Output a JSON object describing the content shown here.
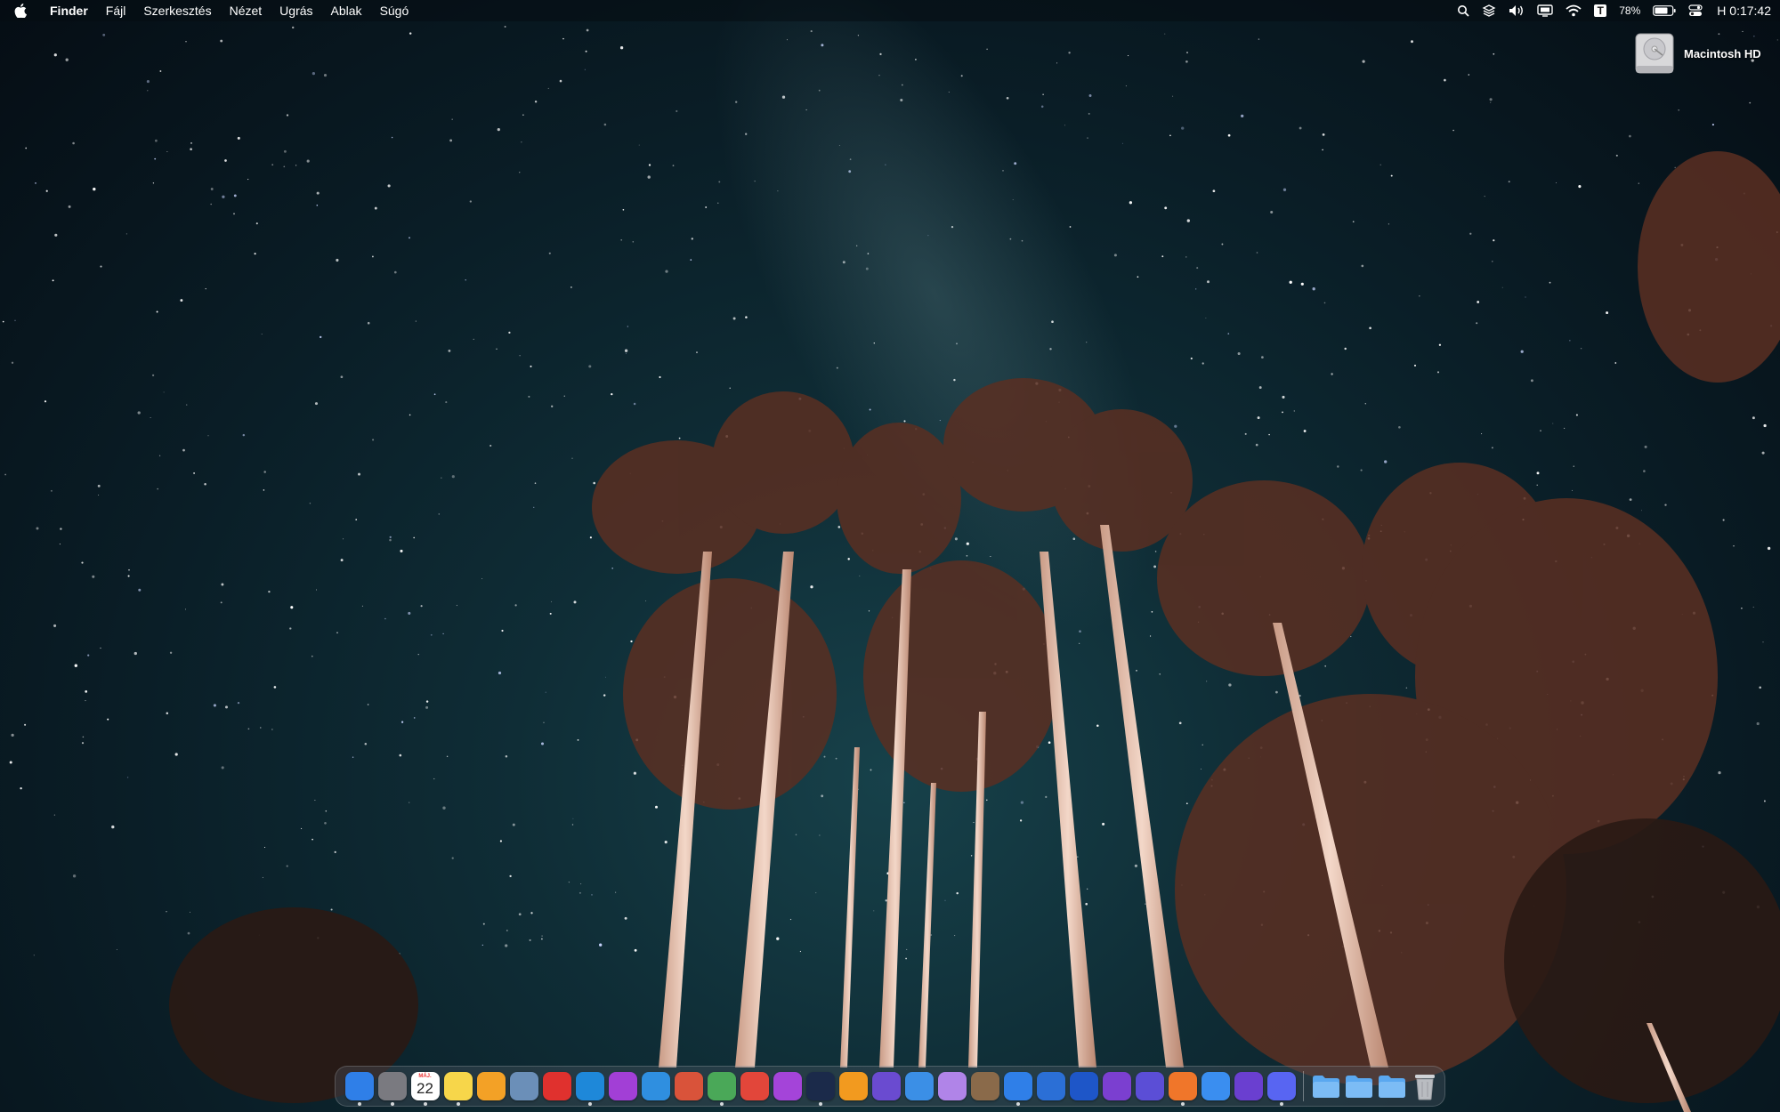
{
  "menubar": {
    "app_name": "Finder",
    "menus": [
      "Fájl",
      "Szerkesztés",
      "Nézet",
      "Ugrás",
      "Ablak",
      "Súgó"
    ],
    "battery_percent": "78%",
    "clock": "H 0:17:42",
    "status_icons": [
      "search-icon",
      "layers-icon",
      "volume-icon",
      "display-icon",
      "wifi-icon",
      "text-t-icon",
      "battery-icon",
      "control-center-icon"
    ]
  },
  "desktop": {
    "disk_label": "Macintosh HD"
  },
  "dock": {
    "calendar_month": "MÁJ.",
    "calendar_day": "22",
    "apps": [
      {
        "name": "finder-icon",
        "color": "#2f7fe8"
      },
      {
        "name": "system-settings-icon",
        "color": "#7a7a80"
      },
      {
        "name": "calendar-icon",
        "color": "#ffffff"
      },
      {
        "name": "notes-icon",
        "color": "#f7d64a"
      },
      {
        "name": "pages-icon",
        "color": "#f3a126"
      },
      {
        "name": "preview-icon",
        "color": "#6b8fb8"
      },
      {
        "name": "flow-icon",
        "color": "#e0312e"
      },
      {
        "name": "activity-icon",
        "color": "#1e88d9"
      },
      {
        "name": "affinity-photo-icon",
        "color": "#a23fd6"
      },
      {
        "name": "affinity-designer-icon",
        "color": "#2f8fe0"
      },
      {
        "name": "photo-booth-icon",
        "color": "#d9533a"
      },
      {
        "name": "tree-app-icon",
        "color": "#4aa858"
      },
      {
        "name": "red-app-icon",
        "color": "#e2463a"
      },
      {
        "name": "podcasts-icon",
        "color": "#a444d9"
      },
      {
        "name": "audio-app-icon",
        "color": "#1b2a4a"
      },
      {
        "name": "smile-app-icon",
        "color": "#f29a1f"
      },
      {
        "name": "imovie-icon",
        "color": "#6a4bd0"
      },
      {
        "name": "cloud-app-icon",
        "color": "#3b8fe6"
      },
      {
        "name": "notebook-icon",
        "color": "#b084e8"
      },
      {
        "name": "archive-icon",
        "color": "#8a6a4a"
      },
      {
        "name": "downloader-icon",
        "color": "#2f7fe8"
      },
      {
        "name": "xcode-icon",
        "color": "#2b6fd6"
      },
      {
        "name": "malwarebytes-icon",
        "color": "#1e56c8"
      },
      {
        "name": "vpn-shield-icon",
        "color": "#7b3fd0"
      },
      {
        "name": "compass-app-icon",
        "color": "#5b4ed6"
      },
      {
        "name": "firefox-icon",
        "color": "#f0762a"
      },
      {
        "name": "mail-icon",
        "color": "#3a8ef0"
      },
      {
        "name": "stocks-wave-icon",
        "color": "#6a3fd0"
      },
      {
        "name": "discord-icon",
        "color": "#5865f2"
      }
    ],
    "folders": [
      {
        "name": "documents-folder-icon",
        "color": "#5aa8f0"
      },
      {
        "name": "folder-icon",
        "color": "#5aa8f0"
      },
      {
        "name": "downloads-folder-icon",
        "color": "#5aa8f0"
      }
    ]
  }
}
